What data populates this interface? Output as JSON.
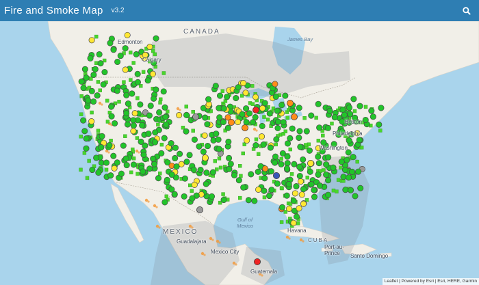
{
  "header": {
    "title": "Fire and Smoke Map",
    "version": "v3.2"
  },
  "map": {
    "labels": {
      "canada": "CANADA",
      "mexico": "MEXICO",
      "cuba": "CUBA",
      "james_bay": "James Bay",
      "edmonton": "Edmonton",
      "calgary": "Calgary",
      "boston": "Boston",
      "philadelphia": "Philadelphia",
      "washington": "Washington",
      "havana": "Havana",
      "gulf_of_mexico": "Gulf of Mexico",
      "guadalajara": "Guadalajara",
      "mexico_city": "Mexico City",
      "guatemala": "Guatemala",
      "port_au_prince": "Port-au-Prince",
      "santo_domingo": "Santo Domingo"
    },
    "attribution": "Leaflet | Powered by Esri | Esri, HERE, Garmin",
    "colors": {
      "good": "#22c42a",
      "moderate": "#ffe733",
      "usg": "#ff8c1a",
      "unhealthy": "#ef2424",
      "very_unhealthy": "#8f3f97",
      "no_data": "#9a9a9a",
      "sensor_square": "#49d62c",
      "fire": "#f39a3a"
    }
  }
}
